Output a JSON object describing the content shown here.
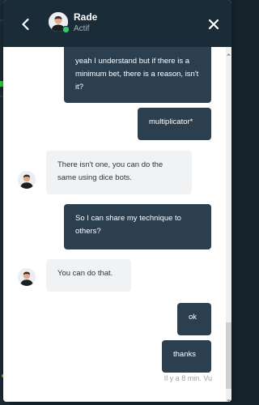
{
  "header": {
    "contact_name": "Rade",
    "contact_status": "Actif",
    "back_icon": "chevron-left-icon",
    "close_icon": "close-icon"
  },
  "messages": [
    {
      "direction": "outgoing",
      "text": "yeah I understand but if there is a minimum bet, there is a reason, isn't it?"
    },
    {
      "direction": "outgoing",
      "text": "multiplicator*"
    },
    {
      "direction": "incoming",
      "text": "There isn't one, you can do the same using dice bots."
    },
    {
      "direction": "outgoing",
      "text": "So I can share my technique to others?"
    },
    {
      "direction": "incoming",
      "text": "You can do that."
    },
    {
      "direction": "outgoing",
      "text": "ok"
    },
    {
      "direction": "outgoing",
      "text": "thanks"
    }
  ],
  "receipt": "Il y a 8 min. Vu",
  "colors": {
    "header_bg": "#1a2c38",
    "outgoing_bubble": "#2c3f4f",
    "incoming_bubble": "#f1f2f4",
    "online_dot": "#2ecc71"
  }
}
